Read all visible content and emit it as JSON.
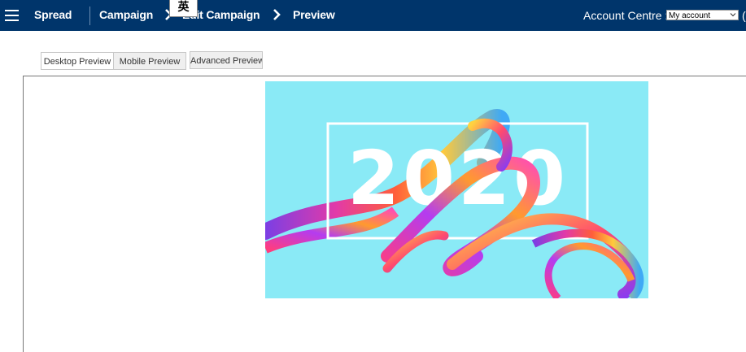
{
  "header": {
    "menu_icon": "hamburger-menu-icon",
    "brand": "Spread",
    "breadcrumbs": [
      "Campaign",
      "Edit Campaign",
      "Preview"
    ],
    "ime_indicator": "英",
    "account_label": "Account Centre :",
    "account_selected": "My account",
    "edge_text": "("
  },
  "tabs": {
    "desktop": "Desktop Preview",
    "mobile": "Mobile Preview",
    "advanced": "Advanced Preview"
  },
  "banner": {
    "year_text": "2020",
    "background_color": "#8aeaf6",
    "frame_color": "#ffffff"
  }
}
